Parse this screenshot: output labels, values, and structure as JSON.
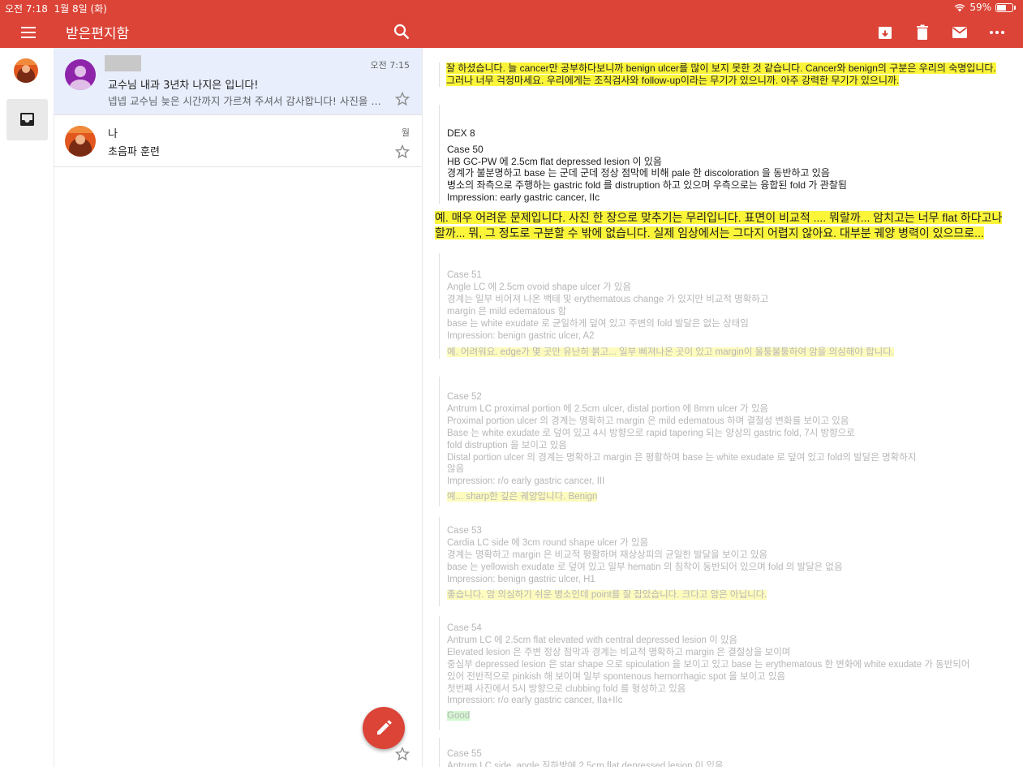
{
  "status": {
    "time": "오전 7:18",
    "date": "1월 8일 (화)",
    "battery": "59%"
  },
  "appbar": {
    "title": "받은편지함",
    "menu_icon": "menu-icon",
    "search_icon": "search-icon",
    "actions": [
      "archive-icon",
      "trash-icon",
      "mail-icon",
      "more-icon"
    ]
  },
  "threads": [
    {
      "sender": "",
      "time": "오전 7:15",
      "subject": "교수님 내과 3년차 나지은 입니다!",
      "snippet": "넵넵 교수님 늦은 시간까지 가르쳐 주셔서 감사합니다! 사진을 더 많이 봐야겠습니다."
    },
    {
      "sender": "나",
      "time": "월",
      "subject": "초음파 훈련",
      "snippet": ""
    }
  ],
  "body": {
    "quote1": [
      "잘 하셨습니다. 늘 cancer만 공부하다보니까 benign ulcer를 많이 보지 못한 것 같습니다. Cancer와  benign의 구분은 우리의 숙명입니다.",
      "그러나 너무 걱정마세요. 우리에게는 조직검사와 follow-up이라는 무기가 있으니까. 아주 강력한 무기가 있으니까."
    ],
    "dex_title": "DEX 8",
    "case50": [
      "Case 50",
      "HB GC-PW 에 2.5cm flat depressed lesion 이 있음",
      "경계가 불분명하고 base 는 군데 군데 정상 점막에 비해 pale 한 discoloration 을 동반하고 있음",
      "병소의 좌측으로 주행하는 gastric fold 를 distruption 하고 있으며 우측으로는 융합된 fold 가 관찰됨",
      "Impression: early gastric cancer, IIc"
    ],
    "reply50": "예. 매우 어려운 문제입니다. 사진 한 장으로 맞추기는 무리입니다. 표면이 비교적 .... 뭐랄까... 암치고는 너무 flat 하다고나 할까... 뭐, 그 정도로 구분할 수 밖에 없습니다. 실제 임상에서는 그다지 어렵지 않아요. 대부분 궤양 병력이 있으므로...",
    "case51": [
      "Case 51",
      "Angle LC 에 2.5cm ovoid shape ulcer 가 있음",
      "경계는 일부 비어져 나온 백태 및 erythematous change 가 있지만 비교적 명확하고",
      "margin 은 mild edematous 함",
      "base 는 white exudate 로 균일하게 덮여 있고 주변의 fold 발달은 없는 상태임",
      "Impression: benign gastric ulcer, A2"
    ],
    "reply51": "예. 어려워요. edge가 몇 곳만 유난히 붉고... 일부 삐져나온 곳이 있고 margin이 울퉁불퉁하여 암을 의심해야 합니다.",
    "case52": [
      "Case 52",
      "Antrum LC proximal portion 에 2.5cm ulcer, distal portion 에 8mm ulcer 가 있음",
      "Proximal portion ulcer 의 경계는 명확하고 margin 은 mild edematous 하며 결절성 변화를 보이고 있음",
      "Base 는 white exudate 로 덮여 있고 4시 방향으로 rapid tapering 되는 양상의 gastric fold, 7시 방향으로",
      "fold distruption 을 보이고 있음",
      "Distal portion ulcer 의 경계는 명확하고 margin 은 평활하며 base 는 white exudate 로 덮여 있고 fold의 발달은 명확하지",
      "않음",
      "Impression: r/o early gastric cancer, III"
    ],
    "reply52": "예... sharp한 깊은 궤양입니다. Benign",
    "case53": [
      "Case 53",
      "Cardia LC side 에 3cm round shape ulcer 가 있음",
      "경계는 명확하고 margin 은 비교적 평활하며 재상상피의 균일한 발달을 보이고 있음",
      "base 는 yellowish exudate 로 덮여 있고 일부 hematin 의 침착이 동반되어 있으며 fold 의 발달은 없음",
      "Impression: benign gastric ulcer, H1"
    ],
    "reply53": "좋습니다. 암 의심하기 쉬운 병소인데 point를 잘 잡았습니다. 크다고 암은 아닙니다.",
    "case54": [
      "Case 54",
      "Antrum LC 에 2.5cm flat elevated with central depressed lesion 이 있음",
      "Elevated lesion 은 주변 정상 점막과 경계는 비교적 명확하고 margin 은 결절상을 보이며",
      "중심부 depressed lesion 은 star shape 으로 spiculation 을 보이고 있고 base 는 erythematous 한 변화에 white exudate 가 동반되어",
      "있어 전반적으로 pinkish 해 보이며 일부 spontenous hemorrhagic spot 을 보이고 있음",
      "첫번째 사진에서 5시 방향으로 clubbing fold 를 형성하고 있음",
      "Impression: r/o early gastric cancer, IIa+IIc"
    ],
    "reply54": "Good",
    "case55": [
      "Case 55",
      "Antrum LC side, angle 직하방에 2.5cm flat depressed lesion 이 있음"
    ]
  }
}
